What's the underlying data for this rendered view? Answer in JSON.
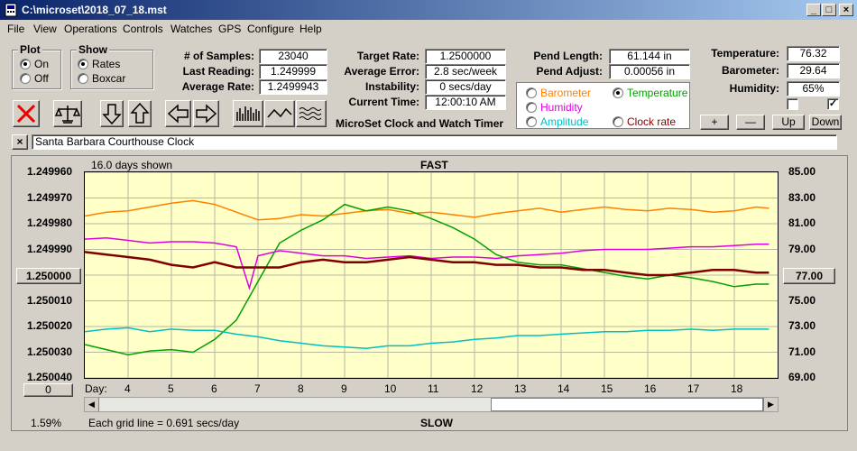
{
  "window": {
    "title": "C:\\microset\\2018_07_18.mst"
  },
  "menu": [
    "File",
    "View",
    "Operations",
    "Controls",
    "Watches",
    "GPS",
    "Configure",
    "Help"
  ],
  "plot_group": {
    "title": "Plot",
    "on": "On",
    "off": "Off",
    "selected": "On"
  },
  "show_group": {
    "title": "Show",
    "rates": "Rates",
    "boxcar": "Boxcar",
    "selected": "Rates"
  },
  "stats": {
    "samples_label": "# of Samples:",
    "samples": "23040",
    "last_label": "Last Reading:",
    "last": "1.249999",
    "avg_label": "Average Rate:",
    "avg": "1.2499943"
  },
  "timing": {
    "target_label": "Target Rate:",
    "target": "1.2500000",
    "error_label": "Average Error:",
    "error": "2.8 sec/week",
    "instab_label": "Instability:",
    "instab": "0 secs/day",
    "time_label": "Current Time:",
    "time": "12:00:10 AM",
    "app_title": "MicroSet Clock and Watch Timer"
  },
  "pendulum": {
    "length_label": "Pend Length:",
    "length": "61.144 in",
    "adjust_label": "Pend Adjust:",
    "adjust": "0.00056 in"
  },
  "sensors": {
    "barometer": "Barometer",
    "temperature": "Temperature",
    "humidity": "Humidity",
    "amplitude": "Amplitude",
    "clock_rate": "Clock rate",
    "selected": "Temperature",
    "colors": {
      "barometer": "#ff8000",
      "temperature": "#00a000",
      "humidity": "#e000e0",
      "amplitude": "#00c0c0",
      "clock_rate": "#800000"
    }
  },
  "env": {
    "temp_label": "Temperature:",
    "temp": "76.32",
    "baro_label": "Barometer:",
    "baro": "29.64",
    "hum_label": "Humidity:",
    "hum": "65%",
    "check1": false,
    "check2": true
  },
  "nav_buttons": {
    "plus": "+",
    "minus": "—",
    "up": "Up",
    "down": "Down"
  },
  "clock_name": {
    "close": "×",
    "value": "Santa Barbara Courthouse Clock"
  },
  "chart_data": {
    "type": "line",
    "title_top": "FAST",
    "title_bottom": "SLOW",
    "days_shown": "16.0 days shown",
    "grid_note": "Each grid line = 0.691 secs/day",
    "zoom": "1.59%",
    "left_ticks": [
      "1.249960",
      "1.249970",
      "1.249980",
      "1.249990",
      "1.250000",
      "1.250010",
      "1.250020",
      "1.250030",
      "1.250040"
    ],
    "left_center_value": "1.250000",
    "right_ticks": [
      "85.00",
      "83.00",
      "81.00",
      "79.00",
      "77.00",
      "75.00",
      "73.00",
      "71.00",
      "69.00"
    ],
    "right_center_value": "77.00",
    "y_left_range": [
      1.24996,
      1.25004
    ],
    "y_right_range": [
      69,
      85
    ],
    "x_label": "Day:",
    "x_ticks": [
      "4",
      "5",
      "6",
      "7",
      "8",
      "9",
      "10",
      "11",
      "12",
      "13",
      "14",
      "15",
      "16",
      "17",
      "18"
    ],
    "x_range": [
      3,
      19
    ],
    "corner_button": "0",
    "series": [
      {
        "name": "Barometer",
        "color": "#ff8000",
        "x": [
          3.0,
          3.5,
          4.0,
          4.5,
          5.0,
          5.5,
          6.0,
          6.5,
          7.0,
          7.5,
          8.0,
          8.5,
          9.0,
          9.5,
          10.0,
          10.5,
          11.0,
          11.5,
          12.0,
          12.5,
          13.0,
          13.5,
          14.0,
          14.5,
          15.0,
          15.5,
          16.0,
          16.5,
          17.0,
          17.5,
          18.0,
          18.5,
          18.8
        ],
        "values": [
          81.6,
          81.9,
          82.0,
          82.3,
          82.6,
          82.8,
          82.5,
          81.9,
          81.3,
          81.4,
          81.7,
          81.6,
          81.8,
          82.0,
          82.1,
          81.8,
          81.9,
          81.7,
          81.5,
          81.8,
          82.0,
          82.2,
          81.9,
          82.1,
          82.3,
          82.1,
          82.0,
          82.2,
          82.1,
          81.9,
          82.0,
          82.3,
          82.2
        ]
      },
      {
        "name": "Temperature",
        "color": "#00a000",
        "x": [
          3.0,
          3.5,
          4.0,
          4.5,
          5.0,
          5.5,
          6.0,
          6.5,
          7.0,
          7.5,
          8.0,
          8.5,
          9.0,
          9.5,
          10.0,
          10.5,
          11.0,
          11.5,
          12.0,
          12.5,
          13.0,
          13.5,
          14.0,
          14.5,
          15.0,
          15.5,
          16.0,
          16.5,
          17.0,
          17.5,
          18.0,
          18.5,
          18.8
        ],
        "values": [
          71.6,
          71.2,
          70.8,
          71.1,
          71.2,
          71.0,
          72.0,
          73.5,
          76.5,
          79.5,
          80.5,
          81.3,
          82.5,
          82.0,
          82.3,
          82.0,
          81.4,
          80.7,
          79.8,
          78.6,
          78.0,
          77.8,
          77.8,
          77.5,
          77.2,
          76.9,
          76.7,
          77.0,
          76.8,
          76.5,
          76.1,
          76.3,
          76.3
        ]
      },
      {
        "name": "Humidity",
        "color": "#e000e0",
        "x": [
          3.0,
          3.5,
          4.0,
          4.5,
          5.0,
          5.5,
          6.0,
          6.5,
          6.8,
          7.0,
          7.5,
          8.0,
          8.5,
          9.0,
          9.5,
          10.0,
          10.5,
          11.0,
          11.5,
          12.0,
          12.5,
          13.0,
          13.5,
          14.0,
          14.5,
          15.0,
          15.5,
          16.0,
          16.5,
          17.0,
          17.5,
          18.0,
          18.5,
          18.8
        ],
        "values": [
          79.8,
          79.9,
          79.7,
          79.5,
          79.6,
          79.6,
          79.5,
          79.2,
          76.0,
          78.5,
          78.9,
          78.7,
          78.5,
          78.5,
          78.3,
          78.4,
          78.5,
          78.3,
          78.4,
          78.4,
          78.3,
          78.5,
          78.6,
          78.7,
          78.9,
          79.0,
          79.0,
          79.0,
          79.1,
          79.2,
          79.2,
          79.3,
          79.4,
          79.4
        ]
      },
      {
        "name": "Amplitude",
        "color": "#00c0c0",
        "x": [
          3.0,
          3.5,
          4.0,
          4.5,
          5.0,
          5.5,
          6.0,
          6.5,
          7.0,
          7.5,
          8.0,
          8.5,
          9.0,
          9.5,
          10.0,
          10.5,
          11.0,
          11.5,
          12.0,
          12.5,
          13.0,
          13.5,
          14.0,
          14.5,
          15.0,
          15.5,
          16.0,
          16.5,
          17.0,
          17.5,
          18.0,
          18.5,
          18.8
        ],
        "values": [
          72.6,
          72.8,
          72.9,
          72.6,
          72.8,
          72.7,
          72.7,
          72.4,
          72.2,
          71.9,
          71.7,
          71.5,
          71.4,
          71.3,
          71.5,
          71.5,
          71.7,
          71.8,
          72.0,
          72.1,
          72.3,
          72.3,
          72.4,
          72.5,
          72.6,
          72.6,
          72.7,
          72.7,
          72.8,
          72.7,
          72.8,
          72.8,
          72.8
        ]
      },
      {
        "name": "Clock rate",
        "color": "#800000",
        "x": [
          3.0,
          3.5,
          4.0,
          4.5,
          5.0,
          5.5,
          6.0,
          6.5,
          7.0,
          7.5,
          8.0,
          8.5,
          9.0,
          9.5,
          10.0,
          10.5,
          11.0,
          11.5,
          12.0,
          12.5,
          13.0,
          13.5,
          14.0,
          14.5,
          15.0,
          15.5,
          16.0,
          16.5,
          17.0,
          17.5,
          18.0,
          18.5,
          18.8
        ],
        "values": [
          1.249991,
          1.249992,
          1.249993,
          1.249994,
          1.249996,
          1.249997,
          1.249995,
          1.249997,
          1.249997,
          1.249997,
          1.249995,
          1.249994,
          1.249995,
          1.249995,
          1.249994,
          1.249993,
          1.249994,
          1.249995,
          1.249995,
          1.249996,
          1.249996,
          1.249997,
          1.249997,
          1.249998,
          1.249998,
          1.249999,
          1.25,
          1.25,
          1.249999,
          1.249998,
          1.249998,
          1.249999,
          1.249999
        ]
      }
    ]
  }
}
